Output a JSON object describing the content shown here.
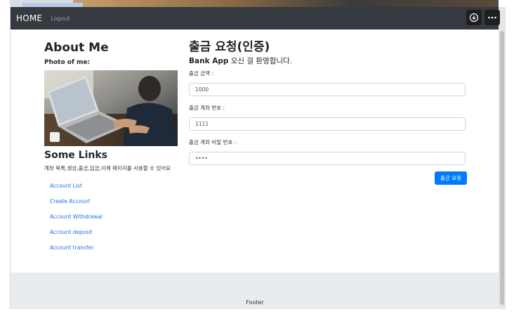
{
  "navbar": {
    "brand": "HOME",
    "logout": "Logout",
    "tools": [
      "download-icon",
      "more-icon"
    ]
  },
  "sidebar": {
    "about_title": "About Me",
    "photo_label": "Photo of me:",
    "links_title": "Some Links",
    "links_desc": "계좌 목록,생성,출금,입금,이체 페이지를 사용할 수 있어요",
    "links": [
      {
        "label": "Account List"
      },
      {
        "label": "Create Account"
      },
      {
        "label": "Account Withdrawal"
      },
      {
        "label": "Account deposit"
      },
      {
        "label": "Account transfer"
      }
    ]
  },
  "main": {
    "title": "출금 요청(인증)",
    "welcome_brand": "Bank App",
    "welcome_rest": " 오신 걸 환영합니다.",
    "amount_label": "출금 금액 :",
    "amount_value": "1000",
    "account_label": "출금 계좌 번호 :",
    "account_value": "1111",
    "password_label": "출금 계좌 비밀 번호 :",
    "password_value": "••••",
    "submit_label": "출금 요청"
  },
  "footer": {
    "text": "Footer"
  },
  "colors": {
    "navbar": "#343a40",
    "accent": "#007bff",
    "link": "#1e73e8",
    "footer_bg": "#e9ecef"
  }
}
